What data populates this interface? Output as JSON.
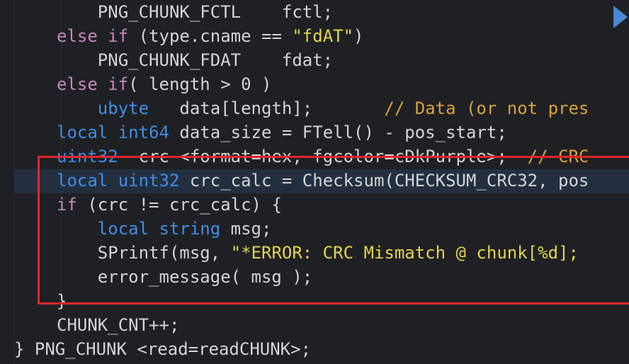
{
  "editor": {
    "lines": [
      [
        {
          "t": "    PNG_CHUNK_FCTL    fctl;",
          "c": "tx"
        }
      ],
      [
        {
          "t": "else if",
          "c": "kw"
        },
        {
          "t": " (type.cname == ",
          "c": "tx"
        },
        {
          "t": "\"fdAT\"",
          "c": "str"
        },
        {
          "t": ")",
          "c": "tx"
        }
      ],
      [
        {
          "t": "    PNG_CHUNK_FDAT    fdat;",
          "c": "tx"
        }
      ],
      [
        {
          "t": "else if",
          "c": "kw"
        },
        {
          "t": "( length > 0 )",
          "c": "tx"
        }
      ],
      [
        {
          "t": "    ",
          "c": "tx"
        },
        {
          "t": "ubyte",
          "c": "ty"
        },
        {
          "t": "   data[length];       ",
          "c": "tx"
        },
        {
          "t": "// Data (or not pres",
          "c": "cm"
        }
      ],
      [
        {
          "t": "local",
          "c": "ty"
        },
        {
          "t": " ",
          "c": "tx"
        },
        {
          "t": "int64",
          "c": "ty"
        },
        {
          "t": " data_size = FTell() - pos_start;",
          "c": "tx"
        }
      ],
      [
        {
          "t": "uint32",
          "c": "ty"
        },
        {
          "t": "  crc <format=hex, fgcolor=cDkPurple>;  ",
          "c": "tx"
        },
        {
          "t": "// CRC",
          "c": "cm"
        }
      ],
      [
        {
          "t": "local",
          "c": "ty"
        },
        {
          "t": " ",
          "c": "tx"
        },
        {
          "t": "uint32",
          "c": "ty"
        },
        {
          "t": " crc_calc = Checksum(CHECKSUM_CRC32, pos",
          "c": "tx"
        }
      ],
      [
        {
          "t": "if",
          "c": "kw"
        },
        {
          "t": " (crc != crc_calc) {",
          "c": "tx"
        }
      ],
      [
        {
          "t": "    ",
          "c": "tx"
        },
        {
          "t": "local",
          "c": "ty"
        },
        {
          "t": " ",
          "c": "tx"
        },
        {
          "t": "string",
          "c": "ty"
        },
        {
          "t": " msg;",
          "c": "tx"
        }
      ],
      [
        {
          "t": "    SPrintf(msg, ",
          "c": "tx"
        },
        {
          "t": "\"*ERROR: CRC Mismatch @ chunk[%d];",
          "c": "str"
        }
      ],
      [
        {
          "t": "    error_message( msg );",
          "c": "tx"
        }
      ],
      [
        {
          "t": "}",
          "c": "tx"
        }
      ],
      [
        {
          "t": "CHUNK_CNT++;",
          "c": "tx"
        }
      ],
      [
        {
          "t": "} PNG_CHUNK <read=readCHUNK>;",
          "c": "tx"
        }
      ]
    ]
  },
  "colors": {
    "keyword": "#c586c0",
    "type": "#3f8ee6",
    "string": "#e2d54b",
    "comment": "#d8a33d",
    "highlight_box": "#e1262b",
    "current_line": "#232f3f"
  },
  "icons": {
    "fold": "fold-arrow-icon"
  }
}
